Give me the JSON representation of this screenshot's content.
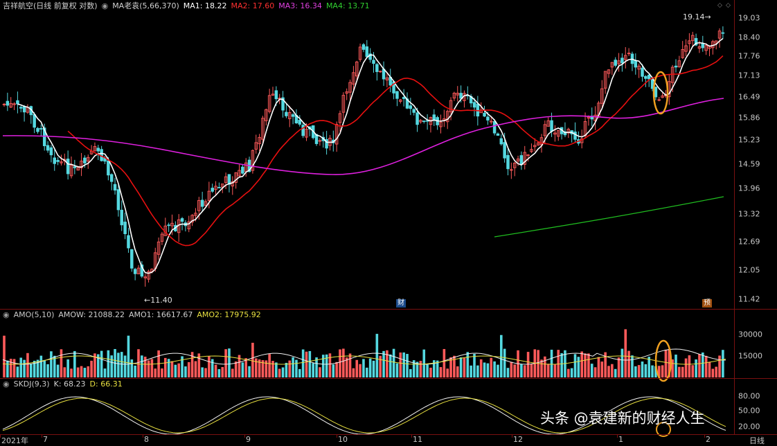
{
  "main_header": {
    "title": "吉祥航空(日线 前复权 对数)",
    "indicator": "MA老袁(5,66,370)",
    "ma1": "MA1: 18.22",
    "ma2": "MA2: 17.60",
    "ma3": "MA3: 16.34",
    "ma4": "MA4: 13.71"
  },
  "amo_header": {
    "name": "AMO(5,10)",
    "amow": "AMOW: 21088.22",
    "amo1": "AMO1: 16617.67",
    "amo2": "AMO2: 17975.92"
  },
  "skdj_header": {
    "name": "SKDJ(9,3)",
    "k": "K: 68.23",
    "d": "D: 66.31"
  },
  "price_axis": [
    "19.03",
    "18.40",
    "17.76",
    "17.13",
    "16.49",
    "15.86",
    "15.23",
    "14.59",
    "13.96",
    "13.32",
    "12.69",
    "12.05",
    "11.42"
  ],
  "amo_axis": [
    "30000",
    "15000"
  ],
  "skdj_axis": [
    "80.00",
    "50.00",
    "20.00"
  ],
  "x_axis": [
    "2021年",
    "7",
    "8",
    "9",
    "10",
    "11",
    "12",
    "1",
    "2"
  ],
  "period_label": "日线",
  "annotations": {
    "low": "←11.40",
    "high": "19.14→",
    "earnings_badge": "财",
    "forecast_badge": "预"
  },
  "watermark": "头条 @袁建新的财经人生",
  "colors": {
    "up": "#ff5a5a",
    "down": "#54d8e0",
    "ma1": "#ffffff",
    "ma2": "#e81010",
    "ma3": "#e020e0",
    "ma4": "#20c020",
    "highlight": "#f0a020"
  },
  "icons": [
    "settings-icon",
    "dropdown-icon"
  ]
}
